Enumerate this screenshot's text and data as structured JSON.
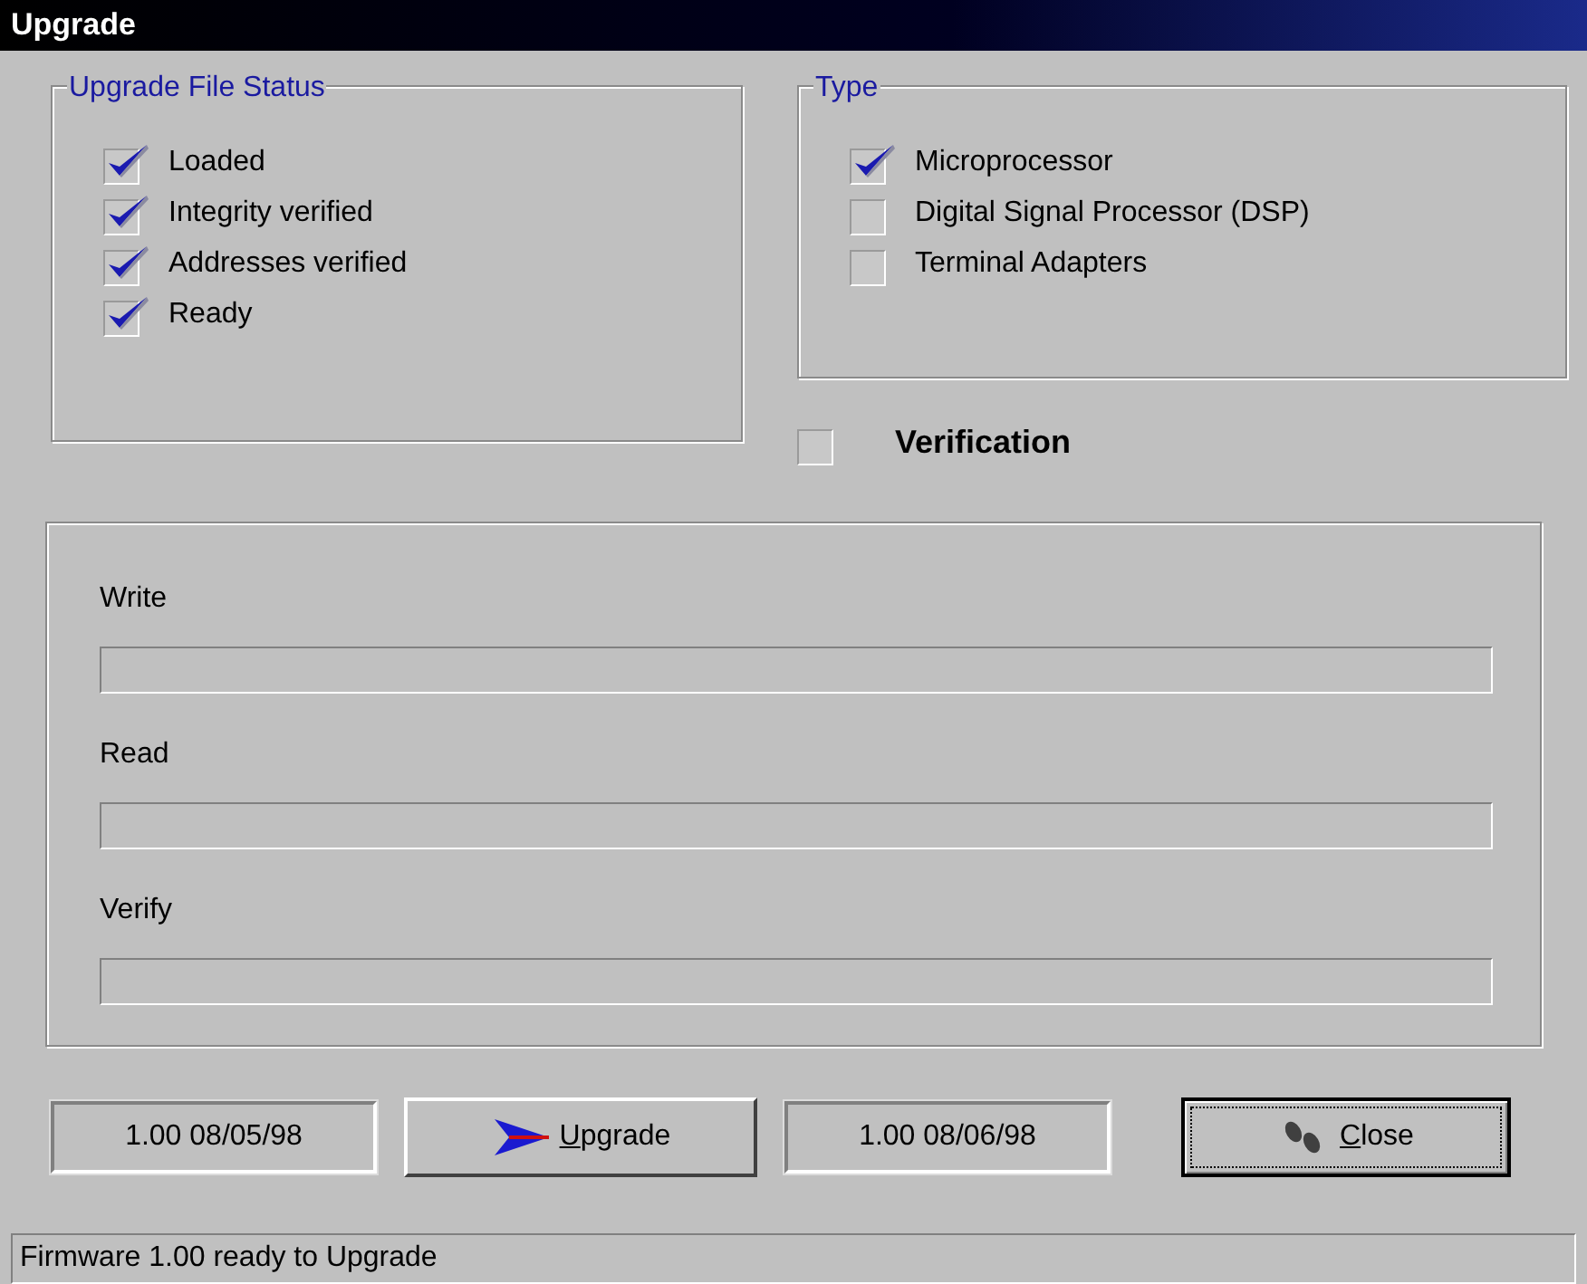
{
  "window": {
    "title": "Upgrade"
  },
  "file_status": {
    "title": "Upgrade File Status",
    "items": [
      {
        "label": "Loaded",
        "checked": true
      },
      {
        "label": "Integrity verified",
        "checked": true
      },
      {
        "label": "Addresses verified",
        "checked": true
      },
      {
        "label": "Ready",
        "checked": true
      }
    ]
  },
  "type": {
    "title": "Type",
    "items": [
      {
        "label": "Microprocessor",
        "checked": true
      },
      {
        "label": "Digital Signal Processor (DSP)",
        "checked": false
      },
      {
        "label": "Terminal Adapters",
        "checked": false
      }
    ]
  },
  "verification": {
    "label": "Verification",
    "checked": false
  },
  "progress": [
    {
      "label": "Write",
      "level": 0
    },
    {
      "label": "Read",
      "level": 0
    },
    {
      "label": "Verify",
      "level": 0
    }
  ],
  "footer": {
    "current_version": "1.00 08/05/98",
    "upgrade_button": {
      "key": "U",
      "rest": "pgrade"
    },
    "new_version": "1.00 08/06/98",
    "close_button": {
      "key": "C",
      "rest": "lose"
    }
  },
  "status_bar": "Firmware 1.00 ready to Upgrade"
}
